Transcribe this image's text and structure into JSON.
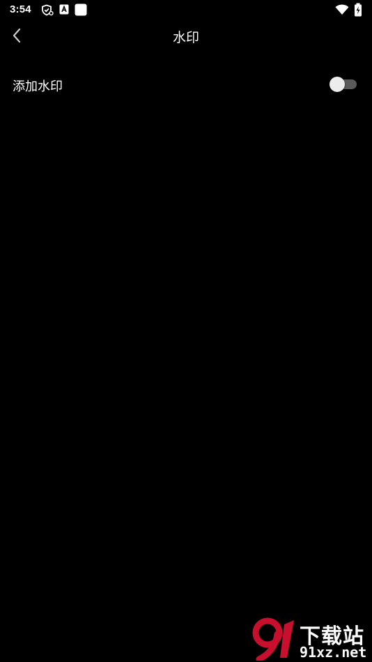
{
  "status_bar": {
    "time": "3:54",
    "icons": [
      "shield-check-icon",
      "app-a-icon",
      "white-square-icon",
      "wifi-icon",
      "battery-charging-icon"
    ]
  },
  "header": {
    "back_icon": "chevron-left-icon",
    "title": "水印"
  },
  "settings": {
    "add_watermark": {
      "label": "添加水印",
      "enabled": false
    }
  },
  "watermark": {
    "logo_text": "91",
    "brand_text": "下载站",
    "url_text": "91xz.net"
  },
  "colors": {
    "background": "#000000",
    "text": "#ffffff",
    "toggle_track_off": "#5a5a5a",
    "toggle_thumb": "#ececec",
    "watermark_red": "#c8102e"
  }
}
